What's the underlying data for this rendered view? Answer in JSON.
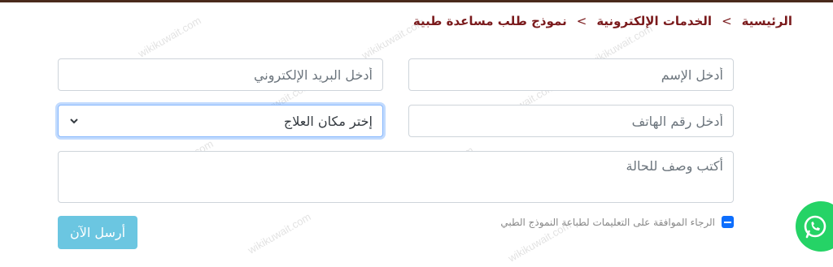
{
  "breadcrumb": {
    "home": "الرئيسية",
    "separator": ">",
    "eservices": "الخدمات الإلكترونية",
    "current": "نموذج طلب مساعدة طبية"
  },
  "form": {
    "name_placeholder": "أدخل الإسم",
    "email_placeholder": "أدخل البريد الإلكتروني",
    "phone_placeholder": "أدخل رقم الهاتف",
    "treatment_select_value": "إختر مكان العلاج",
    "description_placeholder": "أكتب وصف للحالة",
    "terms_label": "الرجاء الموافقة على التعليمات لطباعة النموذج الطبي",
    "submit_label": "أرسل الآن"
  },
  "watermark": {
    "text": "wikikuwait.com"
  },
  "icons": {
    "select_chevron": "chevron-down-icon",
    "checkbox_state": "indeterminate-icon",
    "whatsapp": "whatsapp-icon"
  },
  "colors": {
    "breadcrumb": "#7a1a1c",
    "focus_border": "#86b7fe",
    "checkbox": "#0d6efd",
    "submit": "#5bc0de",
    "whatsapp": "#25d366"
  }
}
